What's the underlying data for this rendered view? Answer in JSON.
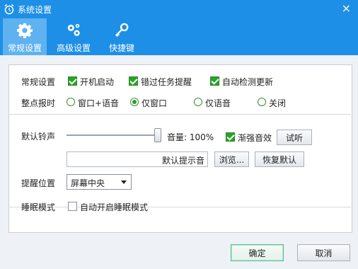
{
  "window": {
    "title": "系统设置",
    "close_glyph": "×"
  },
  "tabs": [
    {
      "label": "常规设置",
      "icon": "gear-icon",
      "active": true
    },
    {
      "label": "高级设置",
      "icon": "gears-icon",
      "active": false
    },
    {
      "label": "快捷键",
      "icon": "key-icon",
      "active": false
    }
  ],
  "general": {
    "section_label": "常规设置",
    "checkboxes": [
      {
        "label": "开机启动",
        "checked": true
      },
      {
        "label": "错过任务提醒",
        "checked": true
      },
      {
        "label": "自动检测更新",
        "checked": true
      }
    ]
  },
  "hourly": {
    "section_label": "整点报时",
    "options": [
      {
        "label": "窗口+语音",
        "selected": false
      },
      {
        "label": "仅窗口",
        "selected": true
      },
      {
        "label": "仅语音",
        "selected": false
      },
      {
        "label": "关闭",
        "selected": false
      }
    ]
  },
  "ringtone": {
    "section_label": "默认铃声",
    "volume_label": "音量: 100%",
    "volume_value": 1.0,
    "fade_in_label": "渐强音效",
    "fade_in_checked": true,
    "preview_button": "试听",
    "file_value": "默认提示音",
    "browse_button": "浏览...",
    "restore_button": "恢复默认"
  },
  "position": {
    "section_label": "提醒位置",
    "selected": "屏幕中央"
  },
  "sleep": {
    "section_label": "睡眠模式",
    "checkbox_label": "自动开启睡眠模式",
    "checked": false
  },
  "footer": {
    "ok_button": "确定",
    "cancel_button": "取消"
  },
  "colors": {
    "titlebar": "#1e8fe6",
    "tab_active": "#5fb2f0",
    "check_green": "#2aa22a"
  }
}
